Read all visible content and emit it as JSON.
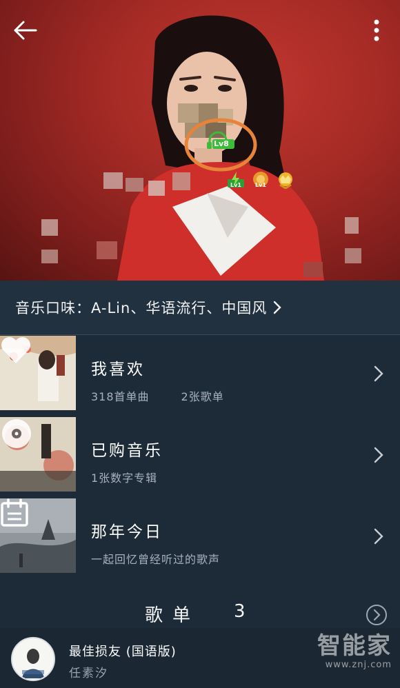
{
  "header": {
    "levels": {
      "main": "Lv8",
      "badge_1": "Lv1",
      "badge_2": "Lv1"
    }
  },
  "taste": {
    "text": "音乐口味：A-Lin、华语流行、中国风"
  },
  "list": [
    {
      "title": "我喜欢",
      "sub": [
        "318首单曲",
        "2张歌单"
      ],
      "icon": "heart-icon"
    },
    {
      "title": "已购音乐",
      "sub": [
        "1张数字专辑"
      ],
      "icon": "vinyl-record-icon"
    },
    {
      "title": "那年今日",
      "sub": [
        "一起回忆曾经听过的歌声"
      ],
      "icon": "calendar-icon"
    }
  ],
  "playlist_section": {
    "title": "歌单",
    "count": "3"
  },
  "player": {
    "title": "最佳损友 (国语版)",
    "artist": "任素汐"
  },
  "watermark": {
    "name": "智能家",
    "url": "www.znj.com"
  },
  "colors": {
    "accent_ring": "#e8843a",
    "level_green": "#3dbb3a",
    "bg": "#1d2b38"
  }
}
